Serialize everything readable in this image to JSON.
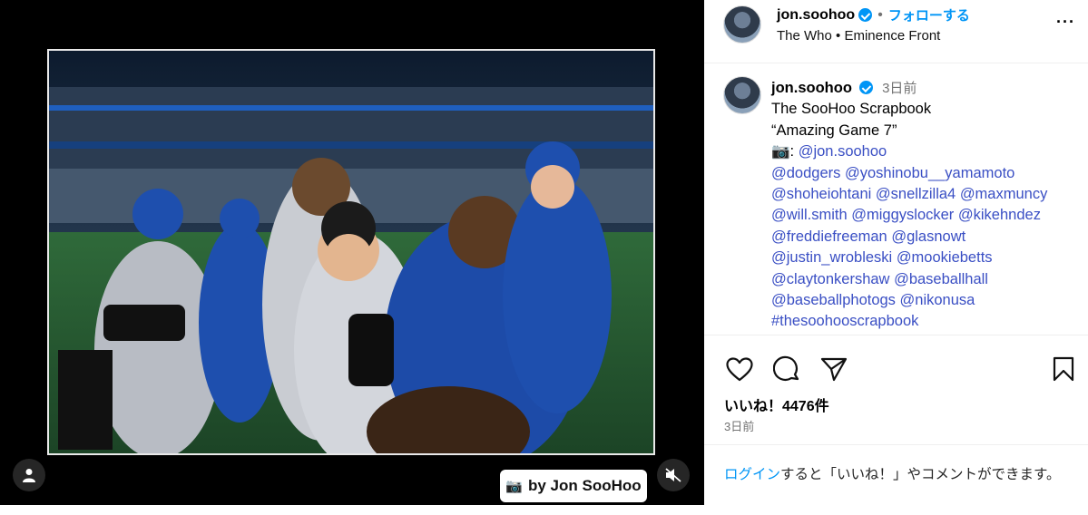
{
  "header": {
    "username": "jon.soohoo",
    "follow_label": "フォローする",
    "audio_title": "The Who",
    "audio_track": "Eminence Front",
    "more_icon": "more-horizontal-icon"
  },
  "caption": {
    "username": "jon.soohoo",
    "time_ago": "3日前",
    "lines": [
      "The SooHoo Scrapbook",
      "“Amazing Game 7”"
    ],
    "camera_prefix": "📷: ",
    "mention_lines": [
      [
        "@jon.soohoo"
      ],
      [
        "@dodgers",
        "@yoshinobu__yamamoto"
      ],
      [
        "@shoheiohtani",
        "@snellzilla4",
        "@maxmuncy"
      ],
      [
        "@will.smith",
        "@miggyslocker",
        "@kikehndez"
      ],
      [
        "@freddiefreeman",
        "@glasnowt"
      ],
      [
        "@justin_wrobleski",
        "@mookiebetts"
      ],
      [
        "@claytonkershaw",
        "@baseballhall"
      ],
      [
        "@baseballphotogs",
        "@nikonusa"
      ],
      [
        "#thesoohooscrapbook"
      ]
    ]
  },
  "media": {
    "credit_label": "by Jon SooHoo",
    "tag_icon": "person-tag-icon",
    "mute_icon": "audio-muted-icon"
  },
  "actions": {
    "likes_text": "いいね！4476件",
    "date_text": "3日前"
  },
  "login_prompt": {
    "link_text": "ログイン",
    "rest_text": "すると「いいね！」やコメントができます。"
  },
  "colors": {
    "link_blue": "#0095f6",
    "mention_blue": "#3a4fc4",
    "dodger_blue": "#1e4fae"
  }
}
